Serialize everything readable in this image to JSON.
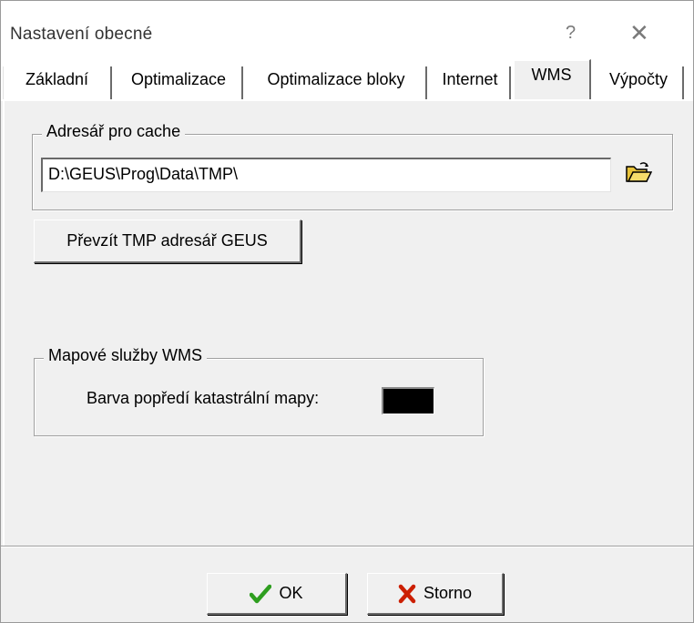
{
  "window": {
    "title": "Nastavení obecné",
    "help_glyph": "?",
    "close_glyph": "✕"
  },
  "tabs": [
    {
      "label": "Základní",
      "active": false
    },
    {
      "label": "Optimalizace",
      "active": false
    },
    {
      "label": "Optimalizace bloky",
      "active": false
    },
    {
      "label": "Internet",
      "active": false
    },
    {
      "label": "WMS",
      "active": true
    },
    {
      "label": "Výpočty",
      "active": false
    }
  ],
  "cache_group": {
    "legend": "Adresář pro cache",
    "path_value": "D:\\GEUS\\Prog\\Data\\TMP\\",
    "browse_icon": "folder-open-icon"
  },
  "take_tmp_button": {
    "label": "Převzít TMP adresář GEUS"
  },
  "wms_group": {
    "legend": "Mapové služby WMS",
    "color_label": "Barva popředí katastrální mapy:",
    "color_value": "#000000"
  },
  "footer": {
    "ok_label": "OK",
    "ok_icon": "check-icon",
    "cancel_label": "Storno",
    "cancel_icon": "cross-icon"
  },
  "colors": {
    "dialog_bg": "#f0f0f0",
    "ok_check": "#2e9e1f",
    "cancel_cross": "#cc1f00",
    "folder": "#e8c33a"
  }
}
